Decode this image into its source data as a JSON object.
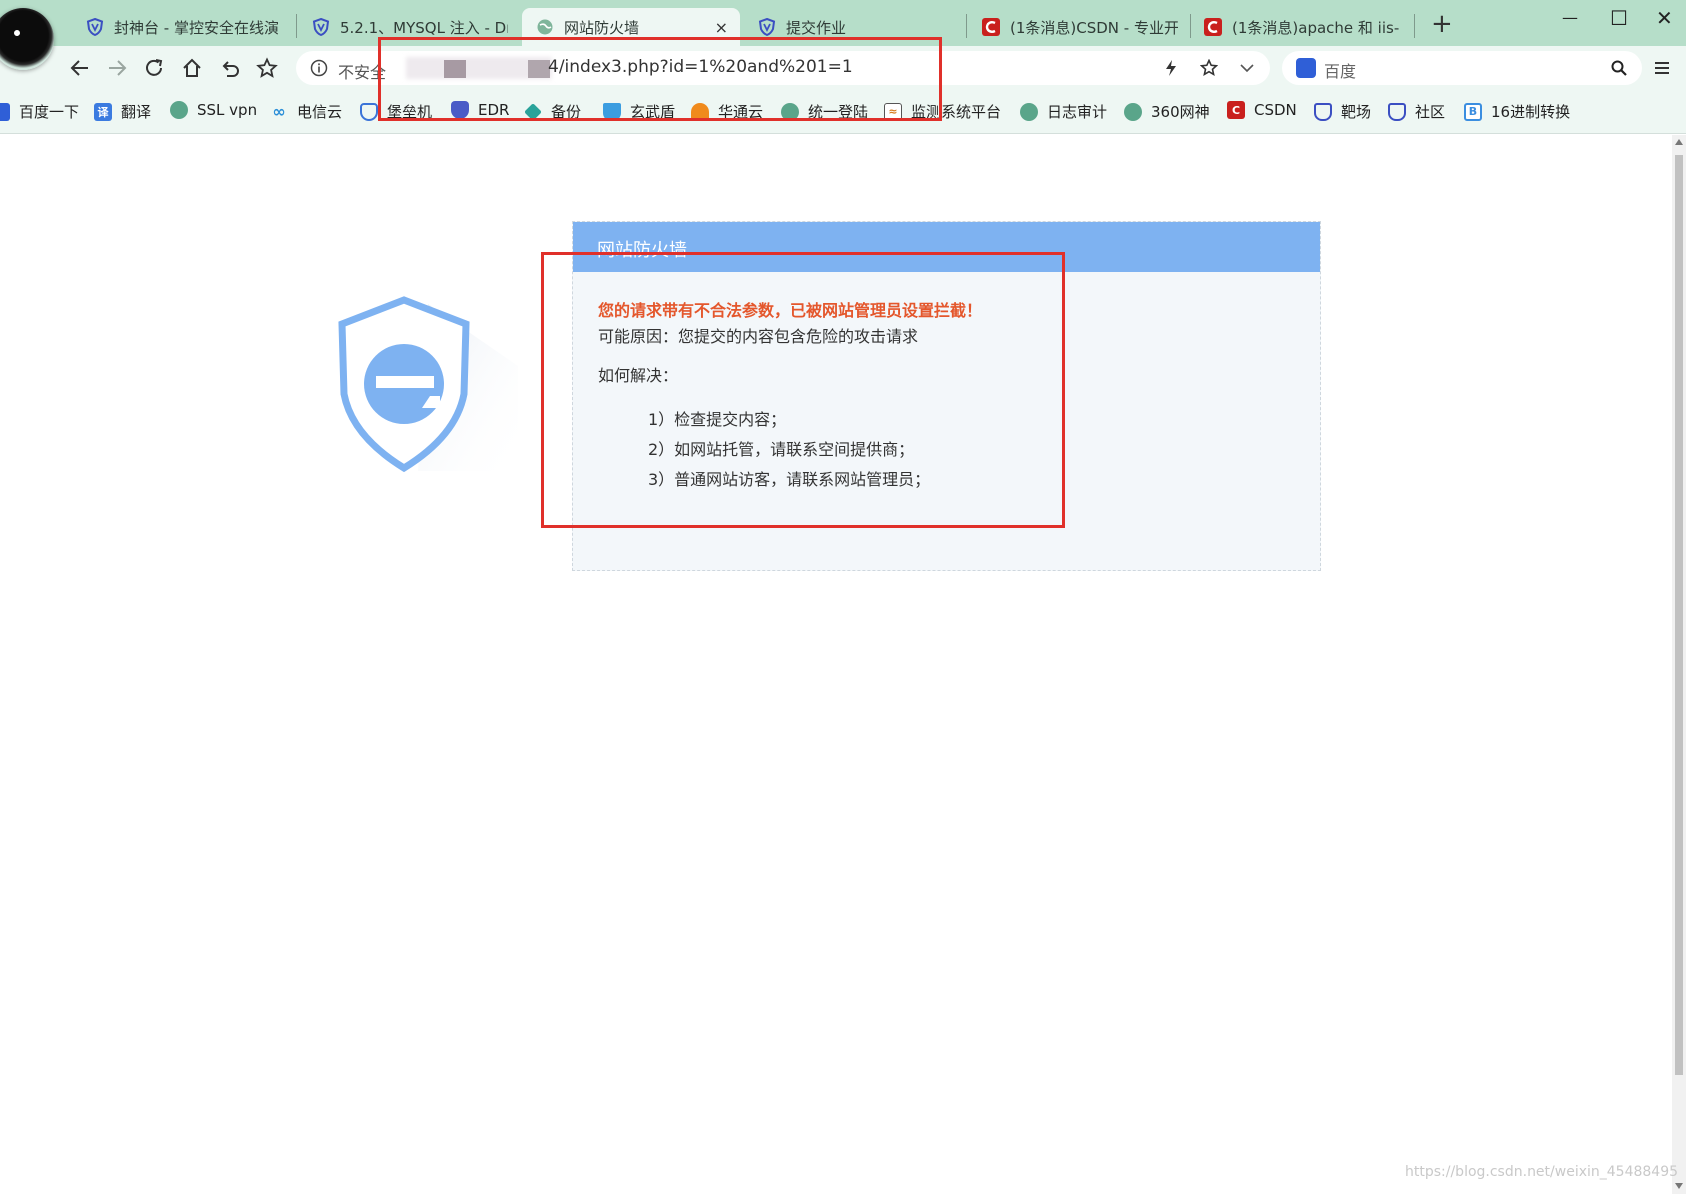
{
  "tabs": [
    {
      "title": "封神台 - 掌控安全在线演",
      "icon": "shield-icon"
    },
    {
      "title": "5.2.1、MYSQL 注入 - Dr",
      "icon": "shield-icon"
    },
    {
      "title": "网站防火墙",
      "icon": "globe-icon",
      "active": true,
      "close": "×"
    },
    {
      "title": "提交作业",
      "icon": "shield-icon"
    },
    {
      "title": "(1条消息)CSDN - 专业开",
      "icon": "csdn-icon"
    },
    {
      "title": "(1条消息)apache 和 iis-",
      "icon": "csdn-icon"
    }
  ],
  "window_controls": {
    "minimize": "—",
    "maximize": "☐",
    "close": "✕",
    "new_tab": "+"
  },
  "address_bar": {
    "security_label": "不安全",
    "url": "4/index3.php?id=1%20and%201=1"
  },
  "search": {
    "placeholder": "百度"
  },
  "bookmarks": [
    {
      "label": "百度一下",
      "icon": "paw-icon",
      "color": "#2f5fd7"
    },
    {
      "label": "翻译",
      "icon": "translate-icon",
      "color": "#3b7be0"
    },
    {
      "label": "SSL vpn",
      "icon": "globe-icon",
      "color": "#5aa58a"
    },
    {
      "label": "电信云",
      "icon": "link-icon",
      "color": "#2c8fd8"
    },
    {
      "label": "堡垒机",
      "icon": "shield-icon",
      "color": "#3b74d8"
    },
    {
      "label": "EDR",
      "icon": "shield-icon",
      "color": "#4a5bc7"
    },
    {
      "label": "备份",
      "icon": "layers-icon",
      "color": "#2aa39a"
    },
    {
      "label": "玄武盾",
      "icon": "cup-icon",
      "color": "#3b9de0"
    },
    {
      "label": "华通云",
      "icon": "cloud-icon",
      "color": "#f08a1c"
    },
    {
      "label": "统一登陆",
      "icon": "globe-icon",
      "color": "#5aa58a"
    },
    {
      "label": "监测系统平台",
      "icon": "chart-icon",
      "color": "#d77d22"
    },
    {
      "label": "日志审计",
      "icon": "globe-icon",
      "color": "#5aa58a"
    },
    {
      "label": "360网神",
      "icon": "globe-icon",
      "color": "#5aa58a"
    },
    {
      "label": "CSDN",
      "icon": "csdn-icon",
      "color": "#c9201d"
    },
    {
      "label": "靶场",
      "icon": "shield-icon",
      "color": "#3b4fc2"
    },
    {
      "label": "社区",
      "icon": "shield-icon",
      "color": "#3b4fc2"
    },
    {
      "label": "16进制转换",
      "icon": "b-icon",
      "color": "#3b8ee0"
    }
  ],
  "firewall": {
    "title": "网站防火墙",
    "warning": "您的请求带有不合法参数，已被网站管理员设置拦截！",
    "reason": "可能原因：您提交的内容包含危险的攻击请求",
    "how_to": "如何解决：",
    "steps": [
      "1）检查提交内容；",
      "2）如网站托管，请联系空间提供商；",
      "3）普通网站访客，请联系网站管理员；"
    ]
  },
  "colors": {
    "header_bar": "#7eb2f1",
    "warning_text": "#e4572c",
    "annotation": "#e0302a",
    "chrome": "#eef7f3",
    "tabstrip": "#b6dec9"
  },
  "watermark": "https://blog.csdn.net/weixin_45488495"
}
